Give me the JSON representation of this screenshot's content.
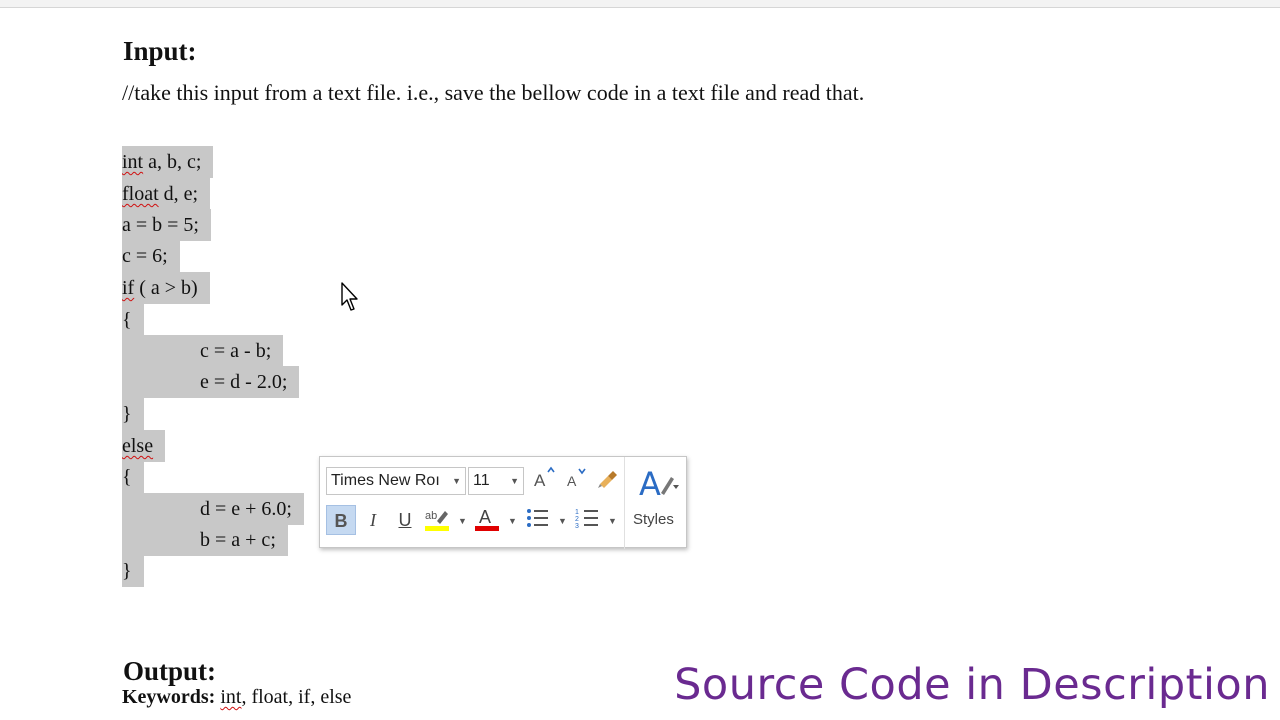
{
  "document": {
    "input_heading": "Input:",
    "instruction": "//take this input from a text file. i.e., save the bellow code in a text file and read that.",
    "code_lines": [
      {
        "pre": "",
        "squiggle": "int",
        "post": " a, b, c;"
      },
      {
        "pre": "",
        "squiggle": "float",
        "post": " d, e;"
      },
      {
        "pre": "",
        "squiggle": "",
        "post": "a = b = 5;"
      },
      {
        "pre": "",
        "squiggle": "",
        "post": "c = 6;"
      },
      {
        "pre": "",
        "squiggle": "if",
        "post": " ( a > b)"
      },
      {
        "pre": "",
        "squiggle": "",
        "post": "{"
      },
      {
        "pre": "",
        "squiggle": "",
        "post": "c = a - b;"
      },
      {
        "pre": "",
        "squiggle": "",
        "post": "e = d - 2.0;"
      },
      {
        "pre": "",
        "squiggle": "",
        "post": "}"
      },
      {
        "pre": "",
        "squiggle": "else",
        "post": ""
      },
      {
        "pre": "",
        "squiggle": "",
        "post": "{"
      },
      {
        "pre": "",
        "squiggle": "",
        "post": "d = e + 6.0;"
      },
      {
        "pre": "",
        "squiggle": "",
        "post": "b = a + c;"
      },
      {
        "pre": "",
        "squiggle": "",
        "post": "}"
      }
    ],
    "output_heading": "Output:",
    "keywords_label": "Keywords:",
    "keywords_first": "int",
    "keywords_rest": ", float, if, else"
  },
  "mini_toolbar": {
    "font_name": "Times New Roı",
    "font_size": "11",
    "bold": "B",
    "italic": "I",
    "underline": "U",
    "styles_label": "Styles",
    "highlight_color": "#ffff00",
    "font_color": "#e00000"
  },
  "banner": {
    "text": "Source Code in Description",
    "color": "#6a2a90"
  }
}
